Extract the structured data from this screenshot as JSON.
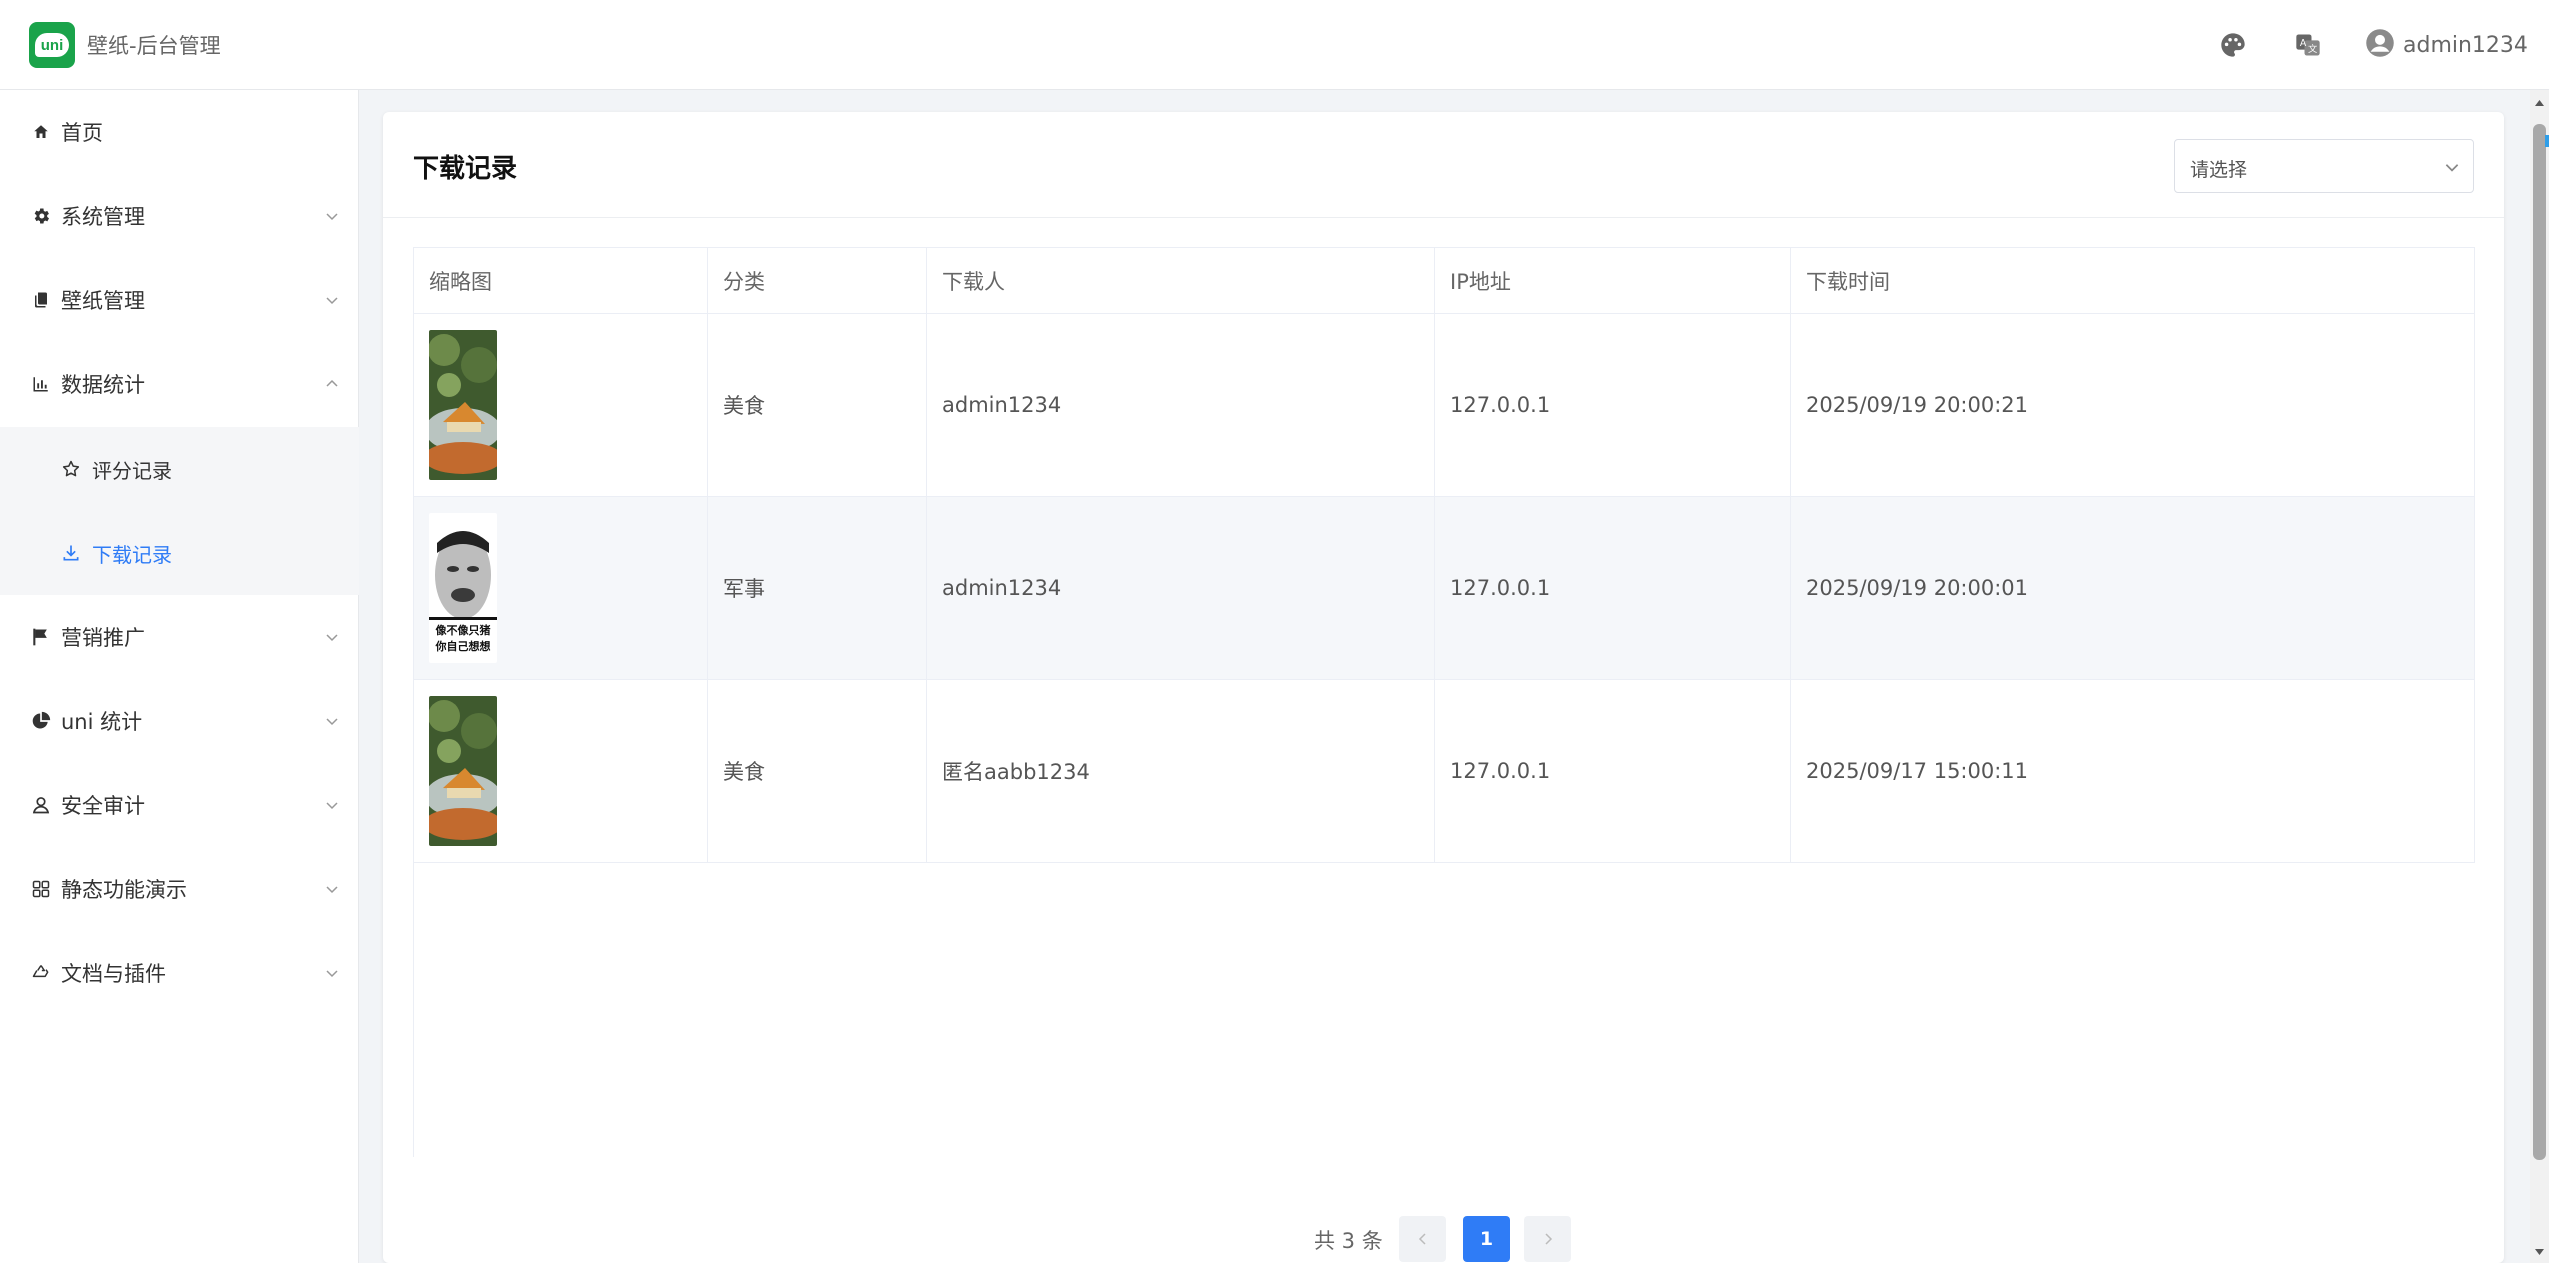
{
  "app": {
    "logo_text": "uni",
    "title": "壁纸-后台管理"
  },
  "header": {
    "theme_icon": "palette-icon",
    "lang_icon": "translate-icon",
    "user_name": "admin1234"
  },
  "sidebar": {
    "items": [
      {
        "label": "首页",
        "icon": "home-icon"
      },
      {
        "label": "系统管理",
        "icon": "gear-icon"
      },
      {
        "label": "壁纸管理",
        "icon": "document-icon"
      },
      {
        "label": "数据统计",
        "icon": "bar-chart-icon",
        "expanded": true
      },
      {
        "label": "营销推广",
        "icon": "flag-icon"
      },
      {
        "label": "uni 统计",
        "icon": "pie-chart-icon"
      },
      {
        "label": "安全审计",
        "icon": "user-icon"
      },
      {
        "label": "静态功能演示",
        "icon": "grid-icon"
      },
      {
        "label": "文档与插件",
        "icon": "recycle-icon"
      }
    ],
    "sub_items": [
      {
        "label": "评分记录",
        "icon": "star-icon"
      },
      {
        "label": "下载记录",
        "icon": "download-icon",
        "active": true
      }
    ]
  },
  "page": {
    "title": "下载记录",
    "select_placeholder": "请选择"
  },
  "table": {
    "columns": [
      "缩略图",
      "分类",
      "下载人",
      "IP地址",
      "下载时间"
    ],
    "rows": [
      {
        "thumb": "food-photo",
        "category": "美食",
        "user": "admin1234",
        "ip": "127.0.0.1",
        "time": "2025/09/19 20:00:21"
      },
      {
        "thumb": "meme-face",
        "thumb_caption_1": "像不像只猪",
        "thumb_caption_2": "你自己想想",
        "category": "军事",
        "user": "admin1234",
        "ip": "127.0.0.1",
        "time": "2025/09/19 20:00:01"
      },
      {
        "thumb": "food-photo",
        "category": "美食",
        "user": "匿名aabb1234",
        "ip": "127.0.0.1",
        "time": "2025/09/17 15:00:11"
      }
    ]
  },
  "pagination": {
    "total_text": "共 3 条",
    "current_page": "1"
  },
  "colors": {
    "primary": "#2f7cf6",
    "logo_green": "#1aa34a"
  }
}
